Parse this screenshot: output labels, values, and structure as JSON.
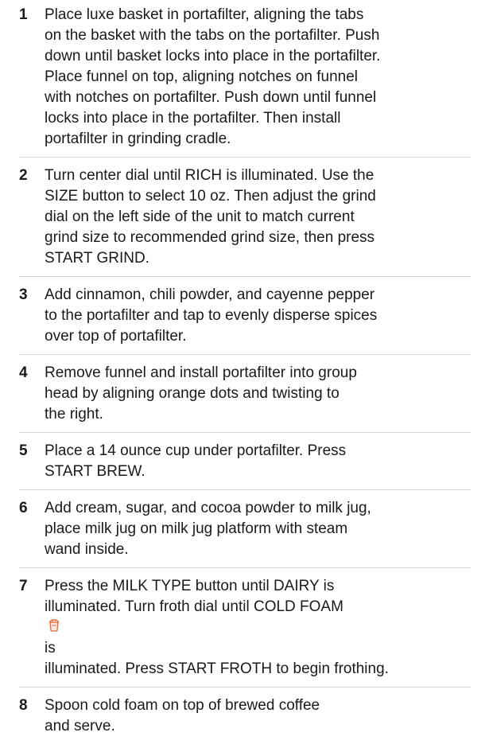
{
  "steps": [
    {
      "number": "1",
      "lines": [
        "Place luxe basket in portafilter, aligning the tabs",
        "on the basket with the tabs on the portafilter. Push",
        "down until basket locks into place in the portafilter.",
        "Place funnel on top, aligning notches on funnel",
        "with notches on portafilter. Push down until funnel",
        "locks into place in the portafilter. Then install",
        "portafilter in grinding cradle."
      ]
    },
    {
      "number": "2",
      "lines": [
        "Turn center dial until RICH is illuminated. Use the",
        "SIZE button to select 10 oz. Then adjust the grind",
        "dial on the left side of the unit to match current",
        "grind size to recommended grind size, then press",
        "START GRIND."
      ]
    },
    {
      "number": "3",
      "lines": [
        "Add cinnamon, chili powder, and cayenne pepper",
        "to the portafilter and tap to evenly disperse spices",
        "over top of portafilter."
      ]
    },
    {
      "number": "4",
      "lines": [
        "Remove funnel and install portafilter into group",
        "head by aligning orange dots and twisting to",
        "the right."
      ]
    },
    {
      "number": "5",
      "lines": [
        "Place a 14 ounce cup under portafilter. Press",
        "START BREW."
      ]
    },
    {
      "number": "6",
      "lines": [
        "Add cream, sugar, and cocoa powder to milk jug,",
        "place milk jug on milk jug platform with steam",
        "wand inside."
      ]
    },
    {
      "number": "7",
      "lines": [
        "Press the MILK TYPE button until DAIRY is",
        "illuminated. Turn froth dial until COLD FOAM",
        "illuminated. Press START FROTH to begin frothing."
      ],
      "inline_icon": "cold-foam-icon",
      "inline_icon_suffix": "is"
    },
    {
      "number": "8",
      "lines": [
        "Spoon cold foam on top of brewed coffee",
        "and serve."
      ]
    }
  ],
  "colors": {
    "text": "#1a1a1a",
    "divider": "#d4d4d4",
    "icon_accent": "#e06a3a"
  }
}
